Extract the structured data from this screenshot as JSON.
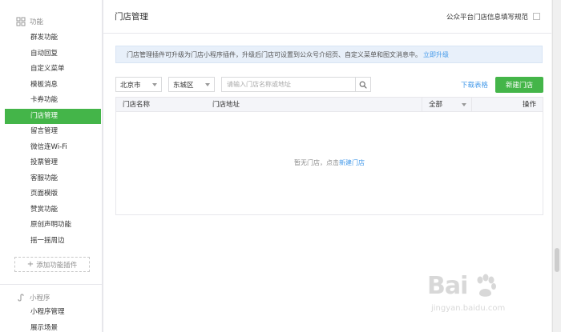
{
  "sidebar": {
    "section_title": "功能",
    "items": [
      {
        "label": "群发功能"
      },
      {
        "label": "自动回复"
      },
      {
        "label": "自定义菜单"
      },
      {
        "label": "模板消息"
      },
      {
        "label": "卡券功能"
      },
      {
        "label": "门店管理",
        "active": true
      },
      {
        "label": "留言管理"
      },
      {
        "label": "微信连Wi-Fi"
      },
      {
        "label": "投票管理"
      },
      {
        "label": "客服功能"
      },
      {
        "label": "页面模版"
      },
      {
        "label": "赞赏功能"
      },
      {
        "label": "原创声明功能"
      },
      {
        "label": "摇一摇周边"
      }
    ],
    "add_plugin": "添加功能插件",
    "mini_section_title": "小程序",
    "mini_items": [
      {
        "label": "小程序管理"
      },
      {
        "label": "展示场景"
      }
    ]
  },
  "header": {
    "title": "门店管理",
    "right_label": "公众平台门店信息填写规范"
  },
  "notice": {
    "text": "门店管理插件可升级为门店小程序插件，升级后门店可设置到公众号介绍页、自定义菜单和图文消息中。",
    "link": "立即升级"
  },
  "toolbar": {
    "city": "北京市",
    "district": "东城区",
    "search_placeholder": "请输入门店名称或地址",
    "download_label": "下载表格",
    "new_store_label": "新建门店"
  },
  "table": {
    "columns": {
      "name": "门店名称",
      "address": "门店地址",
      "filter": "全部",
      "actions": "操作"
    },
    "empty_text": "暂无门店，点击",
    "empty_link": "新建门店"
  },
  "watermark": {
    "title": "Bai",
    "sub": "jingyan.baidu.com"
  },
  "colors": {
    "accent": "#44b549",
    "link": "#459ae9",
    "notice_bg": "#e8f0fa"
  }
}
